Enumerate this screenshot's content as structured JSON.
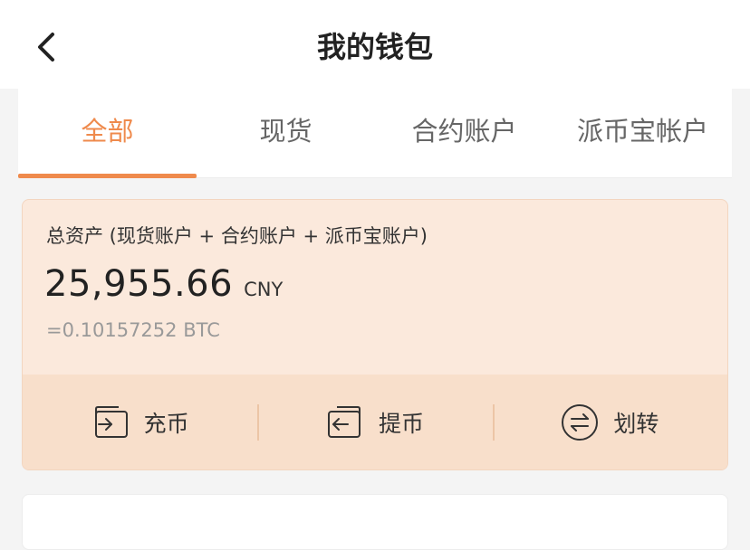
{
  "header": {
    "title": "我的钱包",
    "back_icon": "chevron-left-icon"
  },
  "tabs": [
    {
      "label": "全部",
      "active": true
    },
    {
      "label": "现货",
      "active": false
    },
    {
      "label": "合约账户",
      "active": false
    },
    {
      "label": "派币宝帐户",
      "active": false
    }
  ],
  "asset": {
    "label": "总资产 (现货账户 + 合约账户 + 派币宝账户)",
    "amount": "25,955.66",
    "currency": "CNY",
    "btc_equivalent": "=0.10157252 BTC"
  },
  "actions": [
    {
      "label": "充币",
      "icon": "deposit-icon"
    },
    {
      "label": "提币",
      "icon": "withdraw-icon"
    },
    {
      "label": "划转",
      "icon": "transfer-icon"
    }
  ],
  "colors": {
    "accent": "#ef8a4c",
    "card_bg": "#fbe9dc",
    "action_bar_bg": "#f8dfcb"
  }
}
